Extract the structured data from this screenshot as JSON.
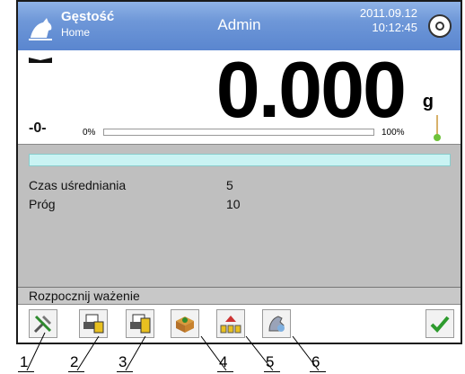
{
  "header": {
    "mode_title": "Gęstość",
    "mode_sub": "Home",
    "user": "Admin",
    "date": "2011.09.12",
    "time": "10:12:45"
  },
  "weighing": {
    "value": "0.000",
    "unit": "g",
    "zero_indicator": "-0-",
    "bar_min": "0%",
    "bar_max": "100%",
    "bar_fill_percent": 0
  },
  "info": {
    "rows": [
      {
        "label": "Czas uśredniania",
        "value": "5"
      },
      {
        "label": "Próg",
        "value": "10"
      }
    ],
    "status": "Rozpocznij ważenie"
  },
  "toolbar": {
    "buttons": [
      {
        "icon": "tools-icon"
      },
      {
        "icon": "print-header-icon"
      },
      {
        "icon": "print-footer-icon"
      },
      {
        "icon": "sample-box-icon"
      },
      {
        "icon": "tare-weights-icon"
      },
      {
        "icon": "hand-density-icon"
      }
    ],
    "confirm_icon": "checkmark-icon"
  },
  "callouts": [
    "1",
    "2",
    "3",
    "4",
    "5",
    "6"
  ]
}
